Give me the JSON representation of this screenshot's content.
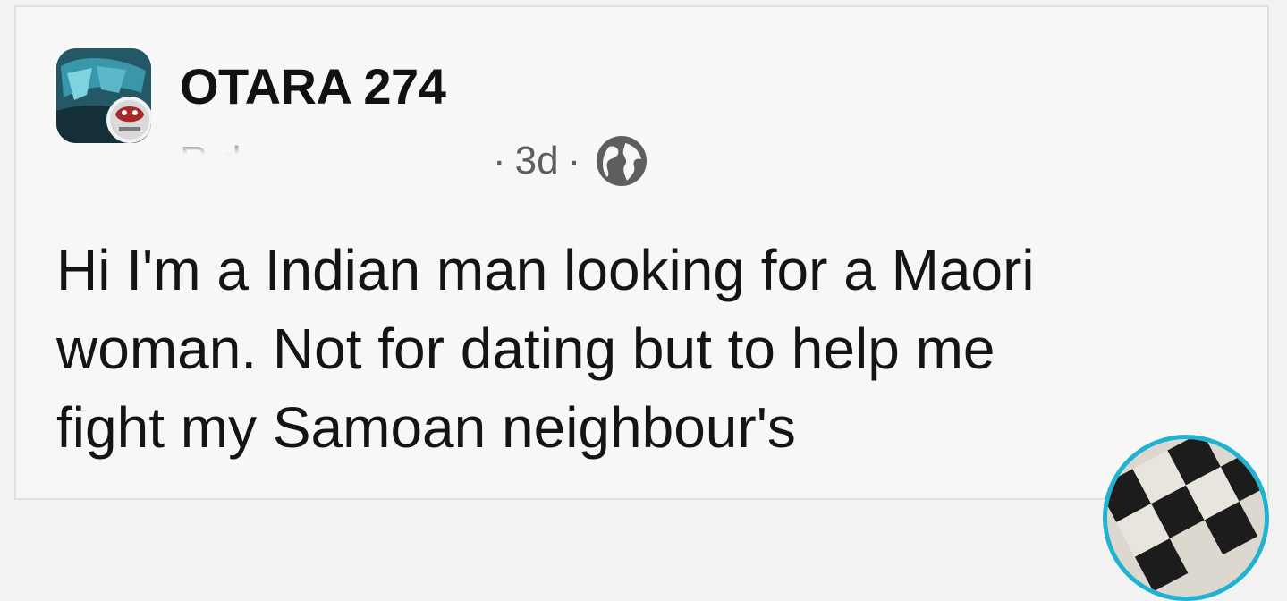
{
  "post": {
    "group_name": "OTARA 274",
    "author": "R                 d",
    "age": "3d",
    "separator": "·",
    "audience_icon": "globe-icon",
    "body": "Hi I'm a Indian man looking for a Maori\nwoman. Not for dating but to help me\nfight my Samoan neighbour's"
  },
  "avatar": {
    "icon": "group-avatar",
    "badge_icon": "mascot-badge-icon"
  },
  "overlay": {
    "icon": "checkered-avatar-icon",
    "ring_color": "#1fb3d1"
  }
}
